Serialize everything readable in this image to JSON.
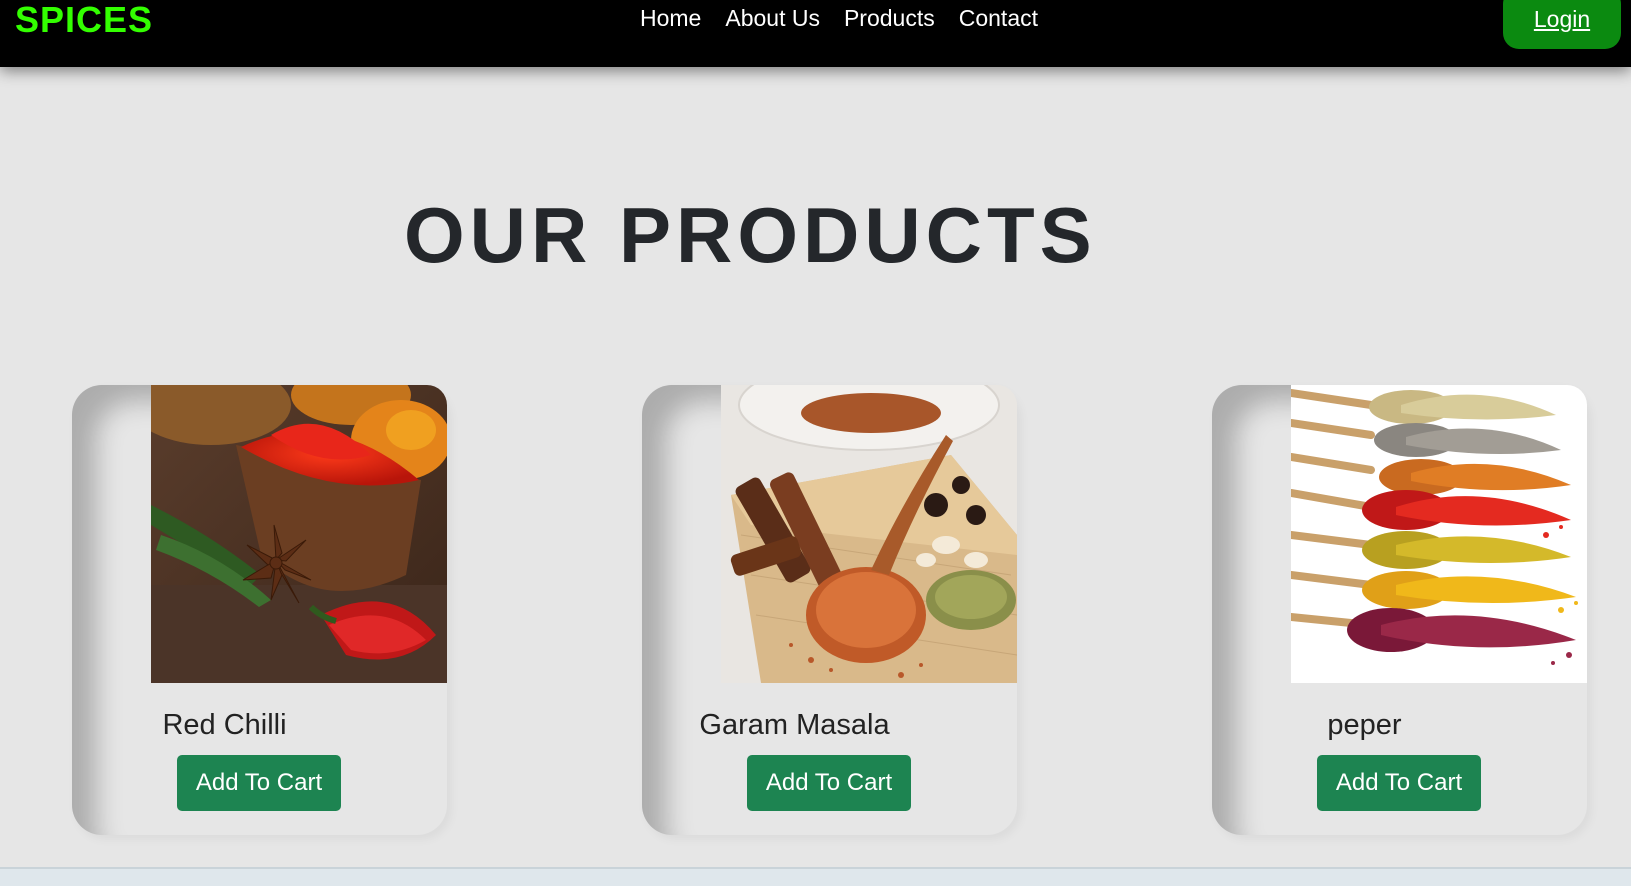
{
  "brand": {
    "name": "SPICES",
    "color": "#33ff00"
  },
  "nav": {
    "links": [
      {
        "label": "Home"
      },
      {
        "label": "About Us"
      },
      {
        "label": "Products"
      },
      {
        "label": "Contact"
      }
    ],
    "login_label": "Login"
  },
  "section": {
    "title": "OUR PRODUCTS"
  },
  "products": [
    {
      "name": "Red Chilli",
      "button_label": "Add To Cart",
      "image_icon": "red-chilli-photo"
    },
    {
      "name": "Garam Masala",
      "button_label": "Add To Cart",
      "image_icon": "garam-masala-photo"
    },
    {
      "name": "peper",
      "button_label": "Add To Cart",
      "image_icon": "spice-spoons-photo"
    }
  ],
  "colors": {
    "navbar_bg": "#000000",
    "login_bg": "#0b8a10",
    "add_button_bg": "#1d8451",
    "page_bg": "#e6e6e6"
  }
}
